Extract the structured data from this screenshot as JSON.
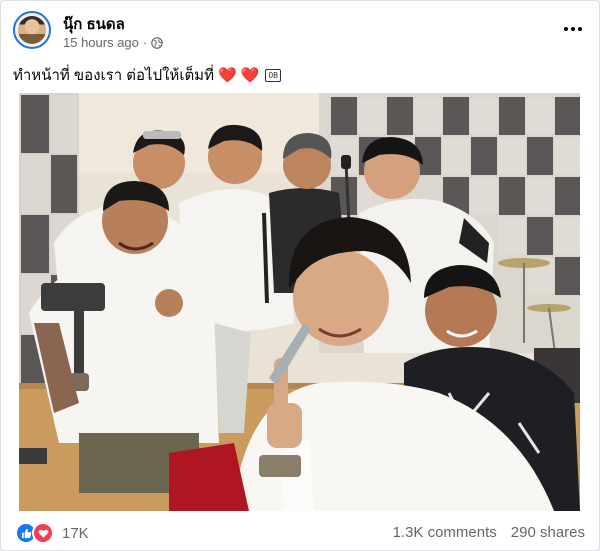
{
  "post": {
    "author": "นุ๊ก ธนดล",
    "time": "15 hours ago",
    "separator": "·",
    "privacy_icon": "globe-icon",
    "caption": "ทำหน้าที่ ของเรา ต่อไปให้เต็มที่",
    "caption_emoji": [
      "❤️",
      "❤️"
    ],
    "caption_badge": "OB"
  },
  "photo": {
    "icon": "group-selfie-photo",
    "colors": {
      "wall": "#e9e2d6",
      "panel_dark": "#575352",
      "panel_light": "#dedad3",
      "floor": "#c89a5c",
      "shirt": "#f5f3ef"
    }
  },
  "footer": {
    "reaction_icons": [
      "like-icon",
      "love-icon"
    ],
    "reaction_count": "17K",
    "comments": "1.3K comments",
    "shares": "290 shares"
  },
  "colors": {
    "accent": "#1877f2",
    "love": "#f33e58",
    "muted_text": "#65676b"
  }
}
